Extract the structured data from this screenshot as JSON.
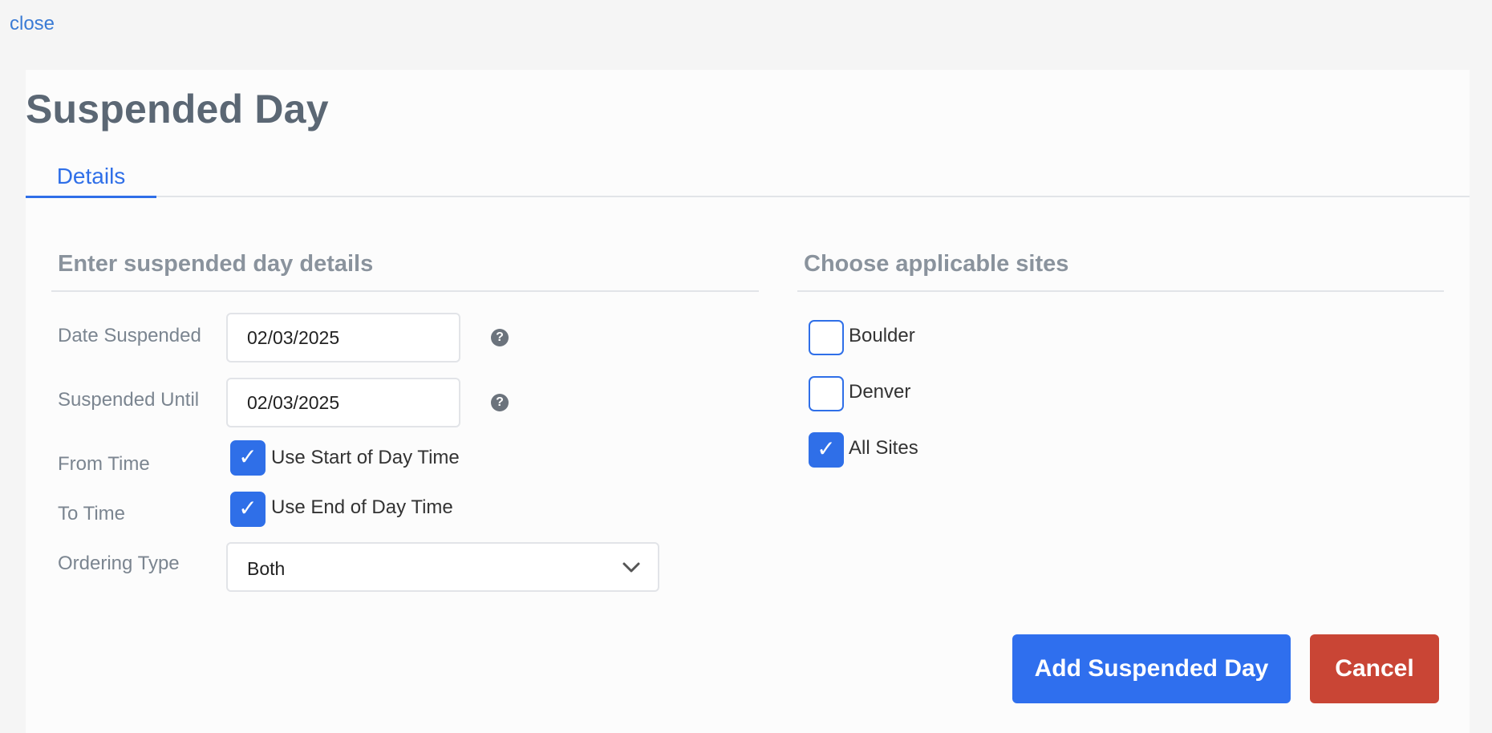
{
  "close_label": "close",
  "title": "Suspended Day",
  "tabs": [
    {
      "label": "Details",
      "active": true
    }
  ],
  "details": {
    "heading": "Enter suspended day details",
    "date_suspended": {
      "label": "Date Suspended",
      "value": "02/03/2025",
      "help": "?"
    },
    "suspended_until": {
      "label": "Suspended Until",
      "value": "02/03/2025",
      "help": "?"
    },
    "from_time": {
      "label": "From Time",
      "option_label": "Use Start of Day Time",
      "checked": true
    },
    "to_time": {
      "label": "To Time",
      "option_label": "Use End of Day Time",
      "checked": true
    },
    "ordering_type": {
      "label": "Ordering Type",
      "value": "Both"
    }
  },
  "sites": {
    "heading": "Choose applicable sites",
    "items": [
      {
        "label": "Boulder",
        "checked": false
      },
      {
        "label": "Denver",
        "checked": false
      },
      {
        "label": "All Sites",
        "checked": true
      }
    ]
  },
  "actions": {
    "add_label": "Add Suspended Day",
    "cancel_label": "Cancel"
  },
  "colors": {
    "accent": "#2f6fe8",
    "danger": "#c94535",
    "title": "#5b6774"
  },
  "icons": {
    "help": "question-circle-icon",
    "check": "checkmark-icon",
    "chevron": "chevron-down-icon"
  }
}
